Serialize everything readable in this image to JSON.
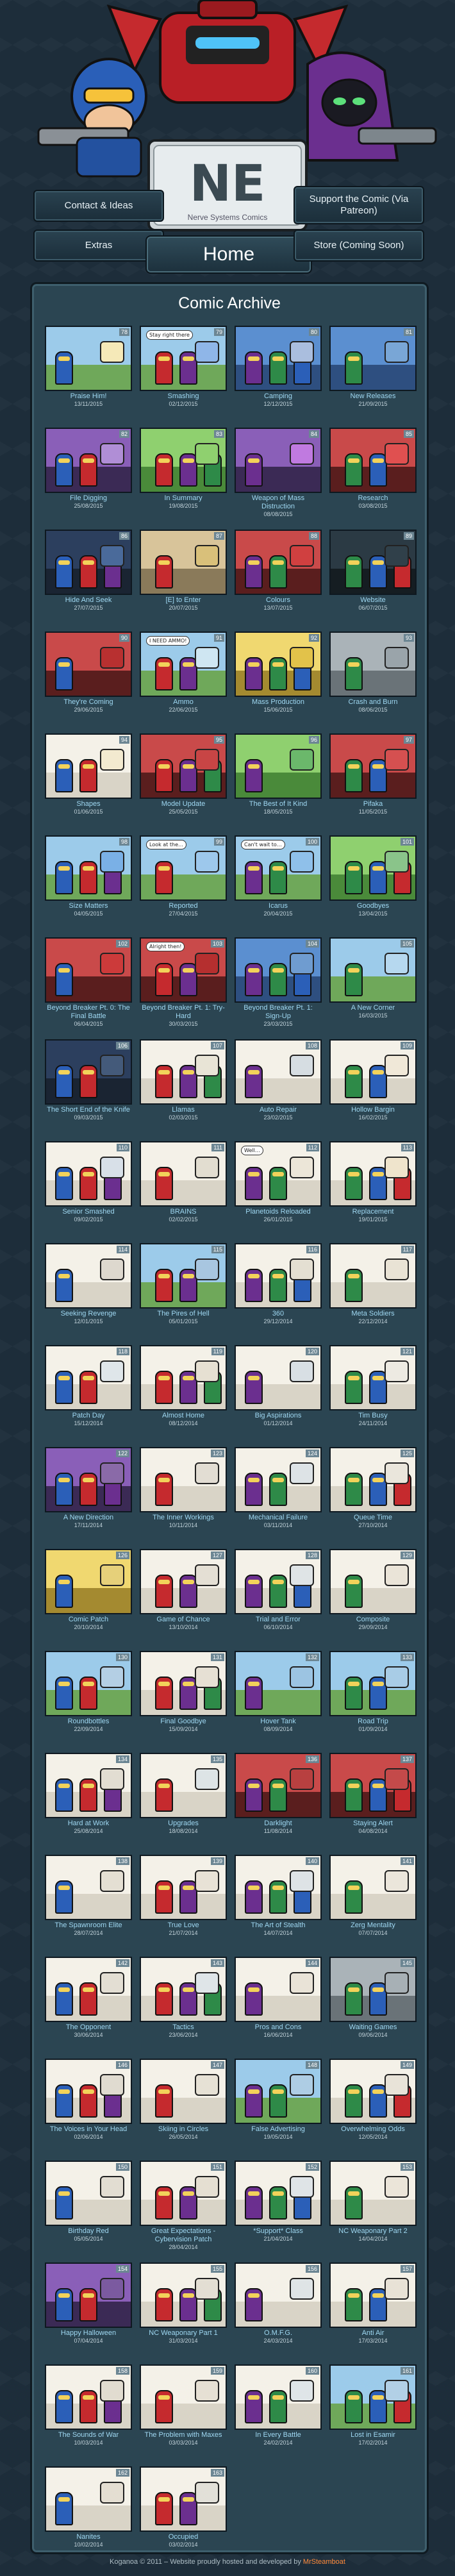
{
  "site": {
    "logo_text": "NE",
    "logo_sub": "Nerve Systems Comics",
    "nav": {
      "contact": "Contact & Ideas",
      "support": "Support the Comic (Via Patreon)",
      "extras": "Extras",
      "home": "Home",
      "store": "Store (Coming Soon)"
    },
    "archive_title": "Comic Archive",
    "footer_prefix": "Koganoa © 2011 – Website proudly hosted and developed by ",
    "footer_author": "MrSteamboat"
  },
  "comics": [
    {
      "num": "78",
      "title": "Praise Him!",
      "date": "13/11/2015",
      "scene": "sky",
      "accent": "#f5e9b8"
    },
    {
      "num": "79",
      "title": "Smashing",
      "date": "02/12/2015",
      "scene": "sky",
      "accent": "#8fb6e8",
      "bubble": "Stay right there"
    },
    {
      "num": "80",
      "title": "Camping",
      "date": "12/12/2015",
      "scene": "blue",
      "accent": "#aabede"
    },
    {
      "num": "81",
      "title": "New Releases",
      "date": "21/09/2015",
      "scene": "blue",
      "accent": "#79a6d6"
    },
    {
      "num": "82",
      "title": "File Digging",
      "date": "25/08/2015",
      "scene": "purple",
      "accent": "#b08ed6"
    },
    {
      "num": "83",
      "title": "In Summary",
      "date": "19/08/2015",
      "scene": "green",
      "accent": "#8fd06f"
    },
    {
      "num": "84",
      "title": "Weapon of Mass Distruction",
      "date": "08/08/2015",
      "scene": "purple",
      "accent": "#c07ae0"
    },
    {
      "num": "85",
      "title": "Research",
      "date": "03/08/2015",
      "scene": "red",
      "accent": "#e05050"
    },
    {
      "num": "86",
      "title": "Hide And Seek",
      "date": "27/07/2015",
      "scene": "night",
      "accent": "#4a6a9a"
    },
    {
      "num": "87",
      "title": "[E] to Enter",
      "date": "20/07/2015",
      "scene": "hall",
      "accent": "#d9c07a"
    },
    {
      "num": "88",
      "title": "Colours",
      "date": "13/07/2015",
      "scene": "red",
      "accent": "#d04040"
    },
    {
      "num": "89",
      "title": "Website",
      "date": "06/07/2015",
      "scene": "dark",
      "accent": "#30404a"
    },
    {
      "num": "90",
      "title": "They're Coming",
      "date": "29/06/2015",
      "scene": "red",
      "accent": "#b83030"
    },
    {
      "num": "91",
      "title": "Ammo",
      "date": "22/06/2015",
      "scene": "sky",
      "accent": "#cfe6f2",
      "bubble": "I NEED AMMO!"
    },
    {
      "num": "92",
      "title": "Mass Production",
      "date": "15/06/2015",
      "scene": "yellow",
      "accent": "#e2c24a"
    },
    {
      "num": "93",
      "title": "Crash and Burn",
      "date": "08/06/2015",
      "scene": "gray",
      "accent": "#9aa4aa"
    },
    {
      "num": "94",
      "title": "Shapes",
      "date": "01/06/2015",
      "scene": "white",
      "accent": "#f3ead0"
    },
    {
      "num": "95",
      "title": "Model Update",
      "date": "25/05/2015",
      "scene": "red",
      "accent": "#c84545"
    },
    {
      "num": "96",
      "title": "The Best of It Kind",
      "date": "18/05/2015",
      "scene": "green",
      "accent": "#6bb86b"
    },
    {
      "num": "97",
      "title": "Pifaka",
      "date": "11/05/2015",
      "scene": "red",
      "accent": "#d55050"
    },
    {
      "num": "98",
      "title": "Size Matters",
      "date": "04/05/2015",
      "scene": "sky",
      "accent": "#7ab0e6"
    },
    {
      "num": "99",
      "title": "Reported",
      "date": "27/04/2015",
      "scene": "sky",
      "accent": "#9dc8ec",
      "bubble": "Look at the…"
    },
    {
      "num": "100",
      "title": "Icarus",
      "date": "20/04/2015",
      "scene": "sky",
      "accent": "#8fc0ea",
      "bubble": "Can't wait to…"
    },
    {
      "num": "101",
      "title": "Goodbyes",
      "date": "13/04/2015",
      "scene": "green",
      "accent": "#8ac48a"
    },
    {
      "num": "102",
      "title": "Beyond Breaker Pt. 0: The Final Battle",
      "date": "06/04/2015",
      "scene": "red",
      "accent": "#cc3a3a"
    },
    {
      "num": "103",
      "title": "Beyond Breaker Pt. 1: Try-Hard",
      "date": "30/03/2015",
      "scene": "red",
      "accent": "#b52f2f",
      "bubble": "Alright then!"
    },
    {
      "num": "104",
      "title": "Beyond Breaker Pt. 1: Sign-Up",
      "date": "23/03/2015",
      "scene": "blue",
      "accent": "#6f9cd0"
    },
    {
      "num": "105",
      "title": "A New Corner",
      "date": "16/03/2015",
      "scene": "sky",
      "accent": "#b6d8ef"
    },
    {
      "num": "106",
      "title": "The Short End of the Knife",
      "date": "09/03/2015",
      "scene": "night",
      "accent": "#445a7a"
    },
    {
      "num": "107",
      "title": "Llamas",
      "date": "02/03/2015",
      "scene": "white",
      "accent": "#e8e4d6"
    },
    {
      "num": "108",
      "title": "Auto Repair",
      "date": "23/02/2015",
      "scene": "white",
      "accent": "#d6dde2"
    },
    {
      "num": "109",
      "title": "Hollow Bargin",
      "date": "16/02/2015",
      "scene": "white",
      "accent": "#f0e8d8"
    },
    {
      "num": "110",
      "title": "Senior Smashed",
      "date": "09/02/2015",
      "scene": "white",
      "accent": "#d8e0e8"
    },
    {
      "num": "111",
      "title": "BRAINS",
      "date": "02/02/2015",
      "scene": "white",
      "accent": "#e2ddd0"
    },
    {
      "num": "112",
      "title": "Planetoids Reloaded",
      "date": "26/01/2015",
      "scene": "white",
      "accent": "#ece6d8",
      "bubble": "Well…"
    },
    {
      "num": "113",
      "title": "Replacement",
      "date": "19/01/2015",
      "scene": "white",
      "accent": "#efe4cc"
    },
    {
      "num": "114",
      "title": "Seeking Revenge",
      "date": "12/01/2015",
      "scene": "white",
      "accent": "#ddd8ce"
    },
    {
      "num": "115",
      "title": "The Pires of Hell",
      "date": "05/01/2015",
      "scene": "sky",
      "accent": "#a8c6e0"
    },
    {
      "num": "116",
      "title": "360",
      "date": "29/12/2014",
      "scene": "white",
      "accent": "#e4dfd2"
    },
    {
      "num": "117",
      "title": "Meta Soldiers",
      "date": "22/12/2014",
      "scene": "white",
      "accent": "#e9e3d5"
    },
    {
      "num": "118",
      "title": "Patch Day",
      "date": "15/12/2014",
      "scene": "white",
      "accent": "#dfe6ea"
    },
    {
      "num": "119",
      "title": "Almost Home",
      "date": "08/12/2014",
      "scene": "white",
      "accent": "#e6e0d2"
    },
    {
      "num": "120",
      "title": "Big Aspirations",
      "date": "01/12/2014",
      "scene": "white",
      "accent": "#d8dfe4"
    },
    {
      "num": "121",
      "title": "Tim Busy",
      "date": "24/11/2014",
      "scene": "white",
      "accent": "#edeae2"
    },
    {
      "num": "122",
      "title": "A New Direction",
      "date": "17/11/2014",
      "scene": "purple",
      "accent": "#8a6aa8"
    },
    {
      "num": "123",
      "title": "The Inner Workings",
      "date": "10/11/2014",
      "scene": "white",
      "accent": "#e2ddd3"
    },
    {
      "num": "124",
      "title": "Mechanical Failure",
      "date": "03/11/2014",
      "scene": "white",
      "accent": "#dde3e6"
    },
    {
      "num": "125",
      "title": "Queue Time",
      "date": "27/10/2014",
      "scene": "white",
      "accent": "#eae6dc"
    },
    {
      "num": "126",
      "title": "Comic Patch",
      "date": "20/10/2014",
      "scene": "yellow",
      "accent": "#e6d07a"
    },
    {
      "num": "127",
      "title": "Game of Chance",
      "date": "13/10/2014",
      "scene": "white",
      "accent": "#e4dfd4"
    },
    {
      "num": "128",
      "title": "Trial and Error",
      "date": "06/10/2014",
      "scene": "white",
      "accent": "#dfe4e6"
    },
    {
      "num": "129",
      "title": "Composite",
      "date": "29/09/2014",
      "scene": "white",
      "accent": "#eae4d8"
    },
    {
      "num": "130",
      "title": "Roundbottles",
      "date": "22/09/2014",
      "scene": "sky",
      "accent": "#b4cfe4"
    },
    {
      "num": "131",
      "title": "Final Goodbye",
      "date": "15/09/2014",
      "scene": "white",
      "accent": "#e6e0d4"
    },
    {
      "num": "132",
      "title": "Hover Tank",
      "date": "08/09/2014",
      "scene": "sky",
      "accent": "#9cc4e2"
    },
    {
      "num": "133",
      "title": "Road Trip",
      "date": "01/09/2014",
      "scene": "sky",
      "accent": "#a8cce6"
    },
    {
      "num": "134",
      "title": "Hard at Work",
      "date": "25/08/2014",
      "scene": "white",
      "accent": "#e2ddd2"
    },
    {
      "num": "135",
      "title": "Upgrades",
      "date": "18/08/2014",
      "scene": "white",
      "accent": "#dde4e6"
    },
    {
      "num": "136",
      "title": "Darklight",
      "date": "11/08/2014",
      "scene": "red",
      "accent": "#b84040"
    },
    {
      "num": "137",
      "title": "Staying Alert",
      "date": "04/08/2014",
      "scene": "red",
      "accent": "#c44a4a"
    },
    {
      "num": "138",
      "title": "The Spawnroom Elite",
      "date": "28/07/2014",
      "scene": "white",
      "accent": "#e4dfd3"
    },
    {
      "num": "139",
      "title": "True Love",
      "date": "21/07/2014",
      "scene": "white",
      "accent": "#e8e2d6"
    },
    {
      "num": "140",
      "title": "The Art of Stealth",
      "date": "14/07/2014",
      "scene": "white",
      "accent": "#dee3e6"
    },
    {
      "num": "141",
      "title": "Zerg Mentality",
      "date": "07/07/2014",
      "scene": "white",
      "accent": "#ebe6db"
    },
    {
      "num": "142",
      "title": "The Opponent",
      "date": "30/06/2014",
      "scene": "white",
      "accent": "#e3ded3"
    },
    {
      "num": "143",
      "title": "Tactics",
      "date": "23/06/2014",
      "scene": "white",
      "accent": "#dfe5e8"
    },
    {
      "num": "144",
      "title": "Pros and Cons",
      "date": "16/06/2014",
      "scene": "white",
      "accent": "#e9e3d7"
    },
    {
      "num": "145",
      "title": "Waiting Games",
      "date": "09/06/2014",
      "scene": "gray",
      "accent": "#a7b0b5"
    },
    {
      "num": "146",
      "title": "The Voices in Your Head",
      "date": "02/06/2014",
      "scene": "white",
      "accent": "#e0dbd0"
    },
    {
      "num": "147",
      "title": "Skiing in Circles",
      "date": "26/05/2014",
      "scene": "white",
      "accent": "#e6e1d5"
    },
    {
      "num": "148",
      "title": "False Advertising",
      "date": "19/05/2014",
      "scene": "sky",
      "accent": "#aecde4"
    },
    {
      "num": "149",
      "title": "Overwhelming Odds",
      "date": "12/05/2014",
      "scene": "white",
      "accent": "#e8e3d8"
    },
    {
      "num": "150",
      "title": "Birthday Red",
      "date": "05/05/2014",
      "scene": "white",
      "accent": "#e2ddd2"
    },
    {
      "num": "151",
      "title": "Great Expectations - Cybervision Patch",
      "date": "28/04/2014",
      "scene": "white",
      "accent": "#e5dfd2"
    },
    {
      "num": "152",
      "title": "*Support* Class",
      "date": "21/04/2014",
      "scene": "white",
      "accent": "#dfe4e7"
    },
    {
      "num": "153",
      "title": "NC Weaponary Part 2",
      "date": "14/04/2014",
      "scene": "white",
      "accent": "#ebe5d9"
    },
    {
      "num": "154",
      "title": "Happy Halloween",
      "date": "07/04/2014",
      "scene": "purple",
      "accent": "#7b5aa0"
    },
    {
      "num": "155",
      "title": "NC Weaponary Part 1",
      "date": "31/03/2014",
      "scene": "white",
      "accent": "#e3ded3"
    },
    {
      "num": "156",
      "title": "O.M.F.G.",
      "date": "24/03/2014",
      "scene": "white",
      "accent": "#dfe4e6"
    },
    {
      "num": "157",
      "title": "Anti Air",
      "date": "17/03/2014",
      "scene": "white",
      "accent": "#e8e2d6"
    },
    {
      "num": "158",
      "title": "The Sounds of War",
      "date": "10/03/2014",
      "scene": "white",
      "accent": "#e1dcd0"
    },
    {
      "num": "159",
      "title": "The Problem with Maxes",
      "date": "03/03/2014",
      "scene": "white",
      "accent": "#e6e0d4"
    },
    {
      "num": "160",
      "title": "In Every Battle",
      "date": "24/02/2014",
      "scene": "white",
      "accent": "#dfe5e8"
    },
    {
      "num": "161",
      "title": "Lost in Esamir",
      "date": "17/02/2014",
      "scene": "sky",
      "accent": "#b2d0e6"
    },
    {
      "num": "162",
      "title": "Nanites",
      "date": "10/02/2014",
      "scene": "white",
      "accent": "#e4ded2"
    },
    {
      "num": "163",
      "title": "Occupied",
      "date": "03/02/2014",
      "scene": "white",
      "accent": "#e2e0d8"
    }
  ]
}
